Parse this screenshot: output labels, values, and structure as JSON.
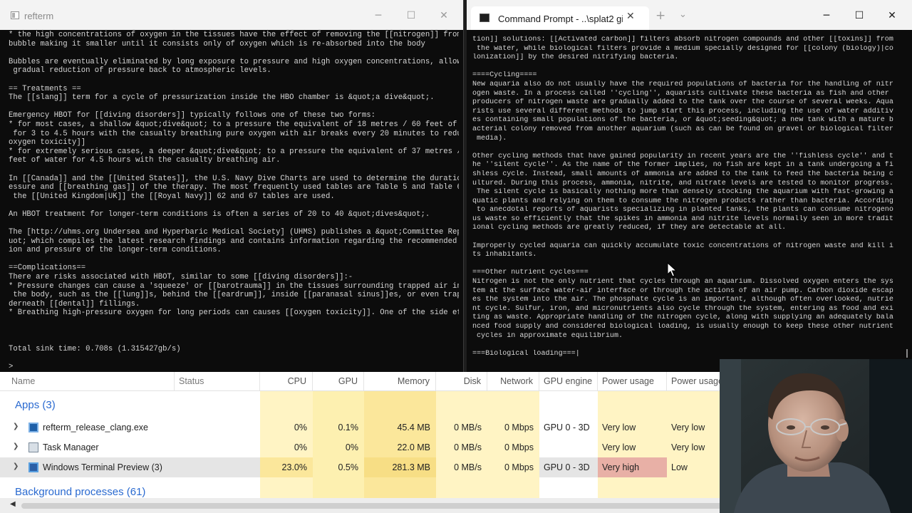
{
  "refterm": {
    "title": "refterm",
    "controls": {
      "minimize": "─",
      "maximize": "☐",
      "close": "✕"
    },
    "lines": [
      "* the high concentrations of oxygen in the tissues have the effect of removing the [[nitrogen]] from the",
      "bubble making it smaller until it consists only of oxygen which is re-absorbed into the body",
      "",
      "Bubbles are eventually eliminated by long exposure to pressure and high oxygen concentrations, allowing a",
      " gradual reduction of pressure back to atmospheric levels.",
      "",
      "== Treatments ==",
      "The [[slang]] term for a cycle of pressurization inside the HBO chamber is &quot;a dive&quot;.",
      "",
      "Emergency HBOT for [[diving disorders]] typically follows one of these two forms:",
      "* for most cases, a shallow &quot;dive&quot; to a pressure the equivalent of 18 metres / 60 feet of water",
      " for 3 to 4.5 hours with the casualty breathing pure oxygen with air breaks every 20 minutes to reduce [[",
      "oxygen toxicity]]",
      "* for extremely serious cases, a deeper &quot;dive&quot; to a pressure the equivalent of 37 metres / 122",
      "feet of water for 4.5 hours with the casualty breathing air.",
      "",
      "In [[Canada]] and the [[United States]], the U.S. Navy Dive Charts are used to determine the duration, pr",
      "essure and [[breathing gas]] of the therapy. The most frequently used tables are Table 5 and Table 6.  In",
      " the [[United Kingdom|UK]] the [[Royal Navy]] 62 and 67 tables are used.",
      "",
      "An HBOT treatment for longer-term conditions is often a series of 20 to 40 &quot;dives&quot;.",
      "",
      "The [http://uhms.org Undersea and Hyperbaric Medical Society] (UHMS) publishes a &quot;Committee Report&q",
      "uot; which compiles the latest research findings and contains information regarding the recommended durat",
      "ion and pressure of the longer-term conditions.",
      "",
      "==Complications==",
      "There are risks associated with HBOT, similar to some [[diving disorders]]:-",
      "* Pressure changes can cause a 'squeeze' or [[barotrauma]] in the tissues surrounding trapped air inside",
      " the body, such as the [[lung]]s, behind the [[eardrum]], inside [[paranasal sinus]]es, or even trapped un",
      "derneath [[dental]] fillings.",
      "* Breathing high-pressure oxygen for long periods can causes [[oxygen toxicity]]. One of the side effects",
      "",
      "",
      "",
      "Total sink time: 0.708s (1.315427gb/s)",
      "",
      ">"
    ]
  },
  "cmd": {
    "tab_title": "Command Prompt - ..\\splat2 gi",
    "tab_close": "✕",
    "new_tab": "+",
    "dropdown": "⌄",
    "controls": {
      "minimize": "─",
      "maximize": "☐",
      "close": "✕"
    },
    "lines": [
      "tion]] solutions: [[Activated carbon]] filters absorb nitrogen compounds and other [[toxins]] from",
      " the water, while biological filters provide a medium specially designed for [[colony (biology)|co",
      "lonization]] by the desired nitrifying bacteria.",
      "",
      "====Cycling====",
      "New aquaria also do not usually have the required populations of bacteria for the handling of nitr",
      "ogen waste. In a process called ''cycling'', aquarists cultivate these bacteria as fish and other",
      "producers of nitrogen waste are gradually added to the tank over the course of several weeks. Aqua",
      "rists use several different methods to jump start this process, including the use of water additiv",
      "es containing small populations of the bacteria, or &quot;seeding&quot; a new tank with a mature b",
      "acterial colony removed from another aquarium (such as can be found on gravel or biological filter",
      " media).",
      "",
      "Other cycling methods that have gained popularity in recent years are the ''fishless cycle'' and t",
      "he ''silent cycle''. As the name of the former implies, no fish are kept in a tank undergoing a fi",
      "shless cycle. Instead, small amounts of ammonia are added to the tank to feed the bacteria being c",
      "ultured. During this process, ammonia, nitrite, and nitrate levels are tested to monitor progress.",
      " The silent cycle is basically nothing more than densely stocking the aquarium with fast-growing a",
      "quatic plants and relying on them to consume the nitrogen products rather than bacteria. According",
      " to anecdotal reports of aquarists specializing in planted tanks, the plants can consume nitrogeno",
      "us waste so efficiently that the spikes in ammonia and nitrite levels normally seen in more tradit",
      "ional cycling methods are greatly reduced, if they are detectable at all.",
      "",
      "Improperly cycled aquaria can quickly accumulate toxic concentrations of nitrogen waste and kill i",
      "ts inhabitants.",
      "",
      "===Other nutrient cycles===",
      "Nitrogen is not the only nutrient that cycles through an aquarium. Dissolved oxygen enters the sys",
      "tem at the surface water-air interface or through the actions of an air pump. Carbon dioxide escap",
      "es the system into the air. The phosphate cycle is an important, although often overlooked, nutrie",
      "nt cycle. Sulfur, iron, and micronutrients also cycle through the system, entering as food and exi",
      "ting as waste. Appropriate handling of the nitrogen cycle, along with supplying an adequately bala",
      "nced food supply and considered biological loading, is usually enough to keep these other nutrient",
      " cycles in approximate equilibrium.",
      "",
      "===Biological loading===|"
    ]
  },
  "task_manager": {
    "columns": {
      "name": "Name",
      "status": "Status",
      "cpu": "CPU",
      "gpu": "GPU",
      "memory": "Memory",
      "disk": "Disk",
      "network": "Network",
      "gpu_engine": "GPU engine",
      "power": "Power usage",
      "power_trend": "Power usage trend"
    },
    "apps_group": "Apps (3)",
    "background_group": "Background processes (61)",
    "rows": [
      {
        "name": "refterm_release_clang.exe",
        "cpu": "0%",
        "gpu": "0.1%",
        "memory": "45.4 MB",
        "disk": "0 MB/s",
        "network": "0 Mbps",
        "gpu_engine": "GPU 0 - 3D",
        "power": "Very low",
        "power_trend": "Very low"
      },
      {
        "name": "Task Manager",
        "cpu": "0%",
        "gpu": "0%",
        "memory": "22.0 MB",
        "disk": "0 MB/s",
        "network": "0 Mbps",
        "gpu_engine": "",
        "power": "Very low",
        "power_trend": "Very low"
      },
      {
        "name": "Windows Terminal Preview (3)",
        "cpu": "23.0%",
        "gpu": "0.5%",
        "memory": "281.3 MB",
        "disk": "0 MB/s",
        "network": "0 Mbps",
        "gpu_engine": "GPU 0 - 3D",
        "power": "Very high",
        "power_trend": "Low"
      }
    ],
    "colors": {
      "cpu_low": "#fff4c4",
      "gpu_low": "#fdf0b0",
      "memory_low": "#fbe79b",
      "power_very_high": "#e8b0a6",
      "selected_row": "#e5e5e5",
      "group_blue": "#2a6ad0"
    }
  }
}
